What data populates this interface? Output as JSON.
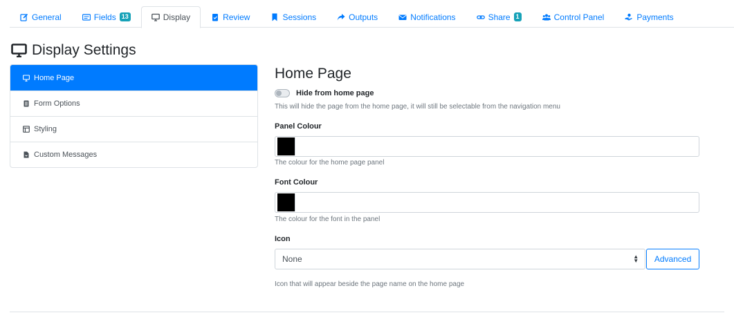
{
  "tabs": [
    {
      "label": "General",
      "icon": "edit-icon"
    },
    {
      "label": "Fields",
      "icon": "form-fields-icon",
      "badge": "13"
    },
    {
      "label": "Display",
      "icon": "desktop-icon"
    },
    {
      "label": "Review",
      "icon": "clipboard-check-icon"
    },
    {
      "label": "Sessions",
      "icon": "bookmark-icon"
    },
    {
      "label": "Outputs",
      "icon": "share-arrow-icon"
    },
    {
      "label": "Notifications",
      "icon": "envelope-icon"
    },
    {
      "label": "Share",
      "icon": "link-icon",
      "badge": "1"
    },
    {
      "label": "Control Panel",
      "icon": "users-icon"
    },
    {
      "label": "Payments",
      "icon": "payment-hand-icon"
    }
  ],
  "active_tab": "Display",
  "page_title": "Display Settings",
  "sidebar": {
    "items": [
      {
        "label": "Home Page",
        "icon": "desktop-icon"
      },
      {
        "label": "Form Options",
        "icon": "list-icon"
      },
      {
        "label": "Styling",
        "icon": "layout-icon"
      },
      {
        "label": "Custom Messages",
        "icon": "file-icon"
      }
    ]
  },
  "main": {
    "section_title": "Home Page",
    "hide_toggle": {
      "label": "Hide from home page",
      "help": "This will hide the page from the home page, it will still be selectable from the navigation menu"
    },
    "panel_colour": {
      "label": "Panel Colour",
      "help": "The colour for the home page panel"
    },
    "font_colour": {
      "label": "Font Colour",
      "help": "The colour for the font in the panel"
    },
    "icon": {
      "label": "Icon",
      "value": "None",
      "advanced_label": "Advanced",
      "help": "Icon that will appear beside the page name on the home page"
    }
  },
  "colors": {
    "primary": "#007bff",
    "badge": "#17a2b8",
    "swatch": "#000000"
  }
}
